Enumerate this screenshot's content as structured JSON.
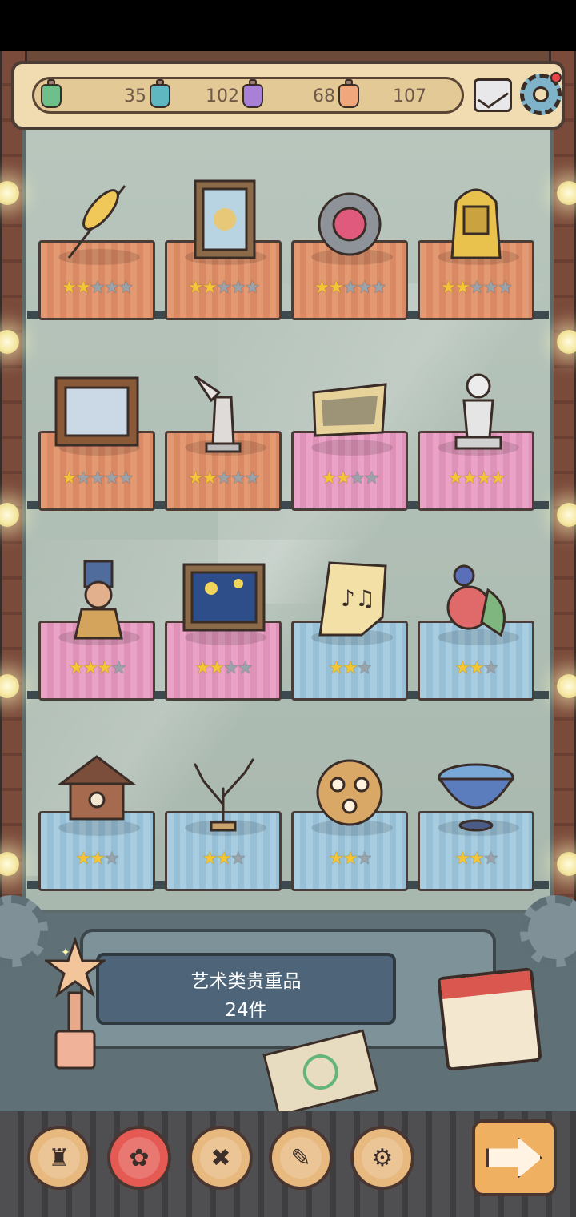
{
  "resources": [
    {
      "color": "#6fbf8a",
      "value": "35"
    },
    {
      "color": "#5fb7c2",
      "value": "102"
    },
    {
      "color": "#a881d6",
      "value": "68"
    },
    {
      "color": "#f0a77b",
      "value": "107"
    }
  ],
  "resources_value_last": "",
  "top_icons": {
    "mail": "mail-icon",
    "settings": "gear-icon"
  },
  "shelves": [
    [
      {
        "item": "golden-wheat",
        "plinth": "orange",
        "stars": 2,
        "max": 5
      },
      {
        "item": "framed-painting",
        "plinth": "orange",
        "stars": 2,
        "max": 5
      },
      {
        "item": "gem-medallion",
        "plinth": "orange",
        "stars": 2,
        "max": 5
      },
      {
        "item": "pharaoh-mask",
        "plinth": "orange",
        "stars": 2,
        "max": 5
      }
    ],
    [
      {
        "item": "family-painting",
        "plinth": "orange",
        "stars": 1,
        "max": 5
      },
      {
        "item": "winged-statue",
        "plinth": "orange",
        "stars": 2,
        "max": 5
      },
      {
        "item": "ancient-scroll",
        "plinth": "pink",
        "stars": 2,
        "max": 4
      },
      {
        "item": "cherub-statue",
        "plinth": "pink",
        "stars": 4,
        "max": 4
      }
    ],
    [
      {
        "item": "queen-bust",
        "plinth": "pink",
        "stars": 3,
        "max": 4
      },
      {
        "item": "starry-night",
        "plinth": "pink",
        "stars": 2,
        "max": 4
      },
      {
        "item": "music-sheet",
        "plinth": "blue",
        "stars": 2,
        "max": 3
      },
      {
        "item": "peacock-clock",
        "plinth": "blue",
        "stars": 2,
        "max": 3
      }
    ],
    [
      {
        "item": "cuckoo-house",
        "plinth": "blue",
        "stars": 2,
        "max": 3
      },
      {
        "item": "coral-branch",
        "plinth": "blue",
        "stars": 2,
        "max": 3
      },
      {
        "item": "bronze-dodecahedron",
        "plinth": "blue",
        "stars": 2,
        "max": 3
      },
      {
        "item": "painted-bowl",
        "plinth": "blue",
        "stars": 2,
        "max": 3
      }
    ]
  ],
  "plaque": {
    "line1": "艺术类贵重品",
    "line2": "24件"
  },
  "nav_buttons": [
    {
      "name": "trophy-cup-icon",
      "glyph": "♜",
      "variant": "plain"
    },
    {
      "name": "rose-icon",
      "glyph": "✿",
      "variant": "rose"
    },
    {
      "name": "cross-tools-icon",
      "glyph": "✖",
      "variant": "plain"
    },
    {
      "name": "scroll-icon",
      "glyph": "✎",
      "variant": "plain"
    },
    {
      "name": "cog-icon",
      "glyph": "⚙",
      "variant": "plain"
    }
  ],
  "next_button": {
    "name": "next-arrow-icon"
  }
}
